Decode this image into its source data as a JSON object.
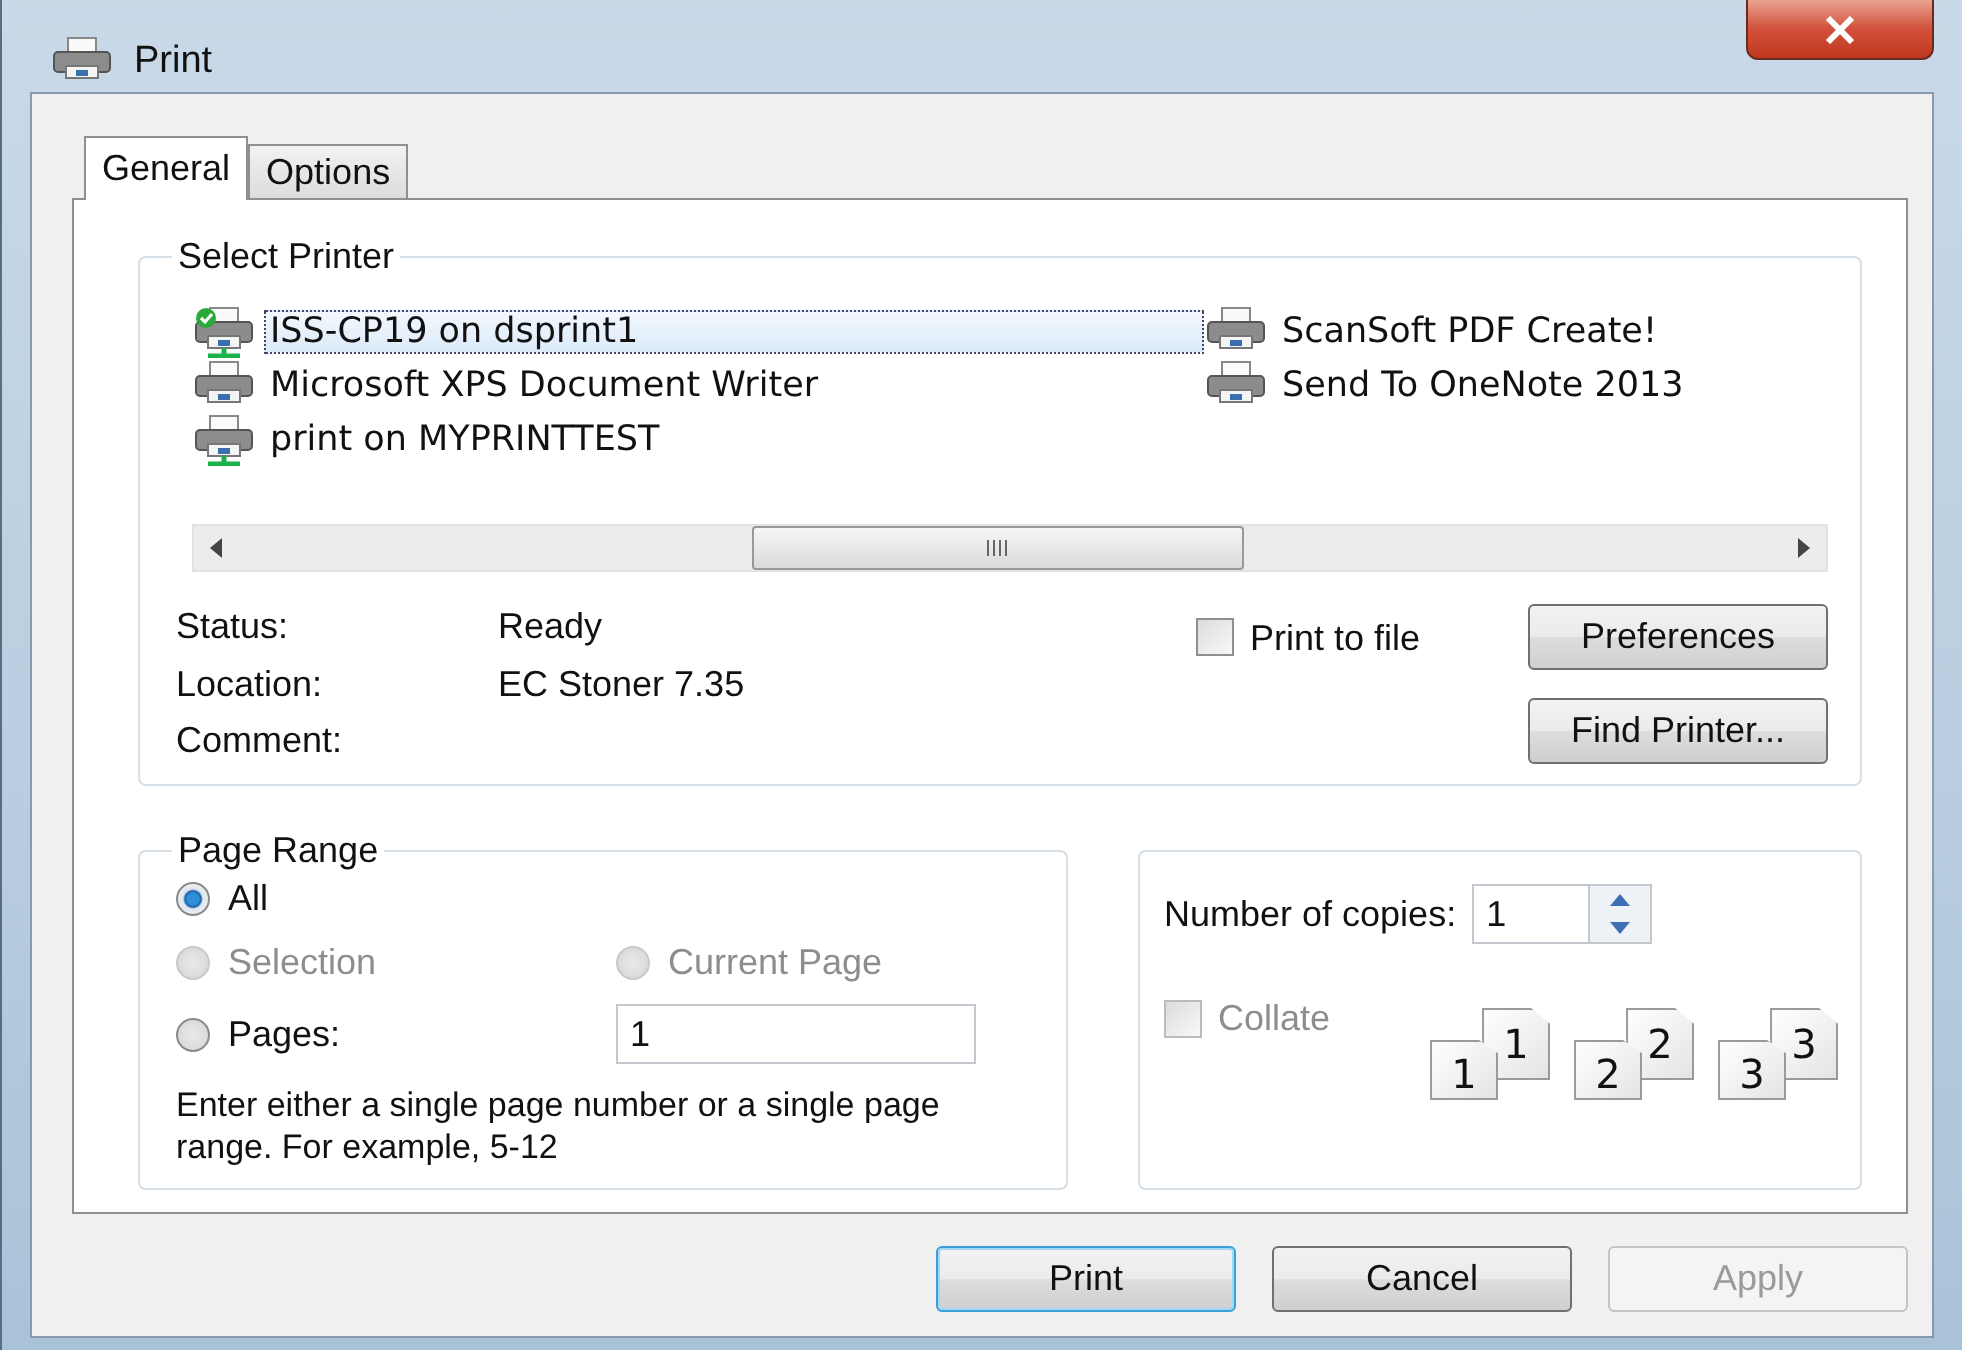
{
  "window": {
    "title": "Print"
  },
  "tabs": [
    {
      "label": "General",
      "selected": true
    },
    {
      "label": "Options",
      "selected": false
    }
  ],
  "select_printer": {
    "title": "Select Printer",
    "printers": [
      {
        "name": "ISS-CP19 on dsprint1",
        "selected": true,
        "default": true,
        "network": true
      },
      {
        "name": "Microsoft XPS Document Writer",
        "selected": false,
        "default": false,
        "network": false
      },
      {
        "name": "print on MYPRINTTEST",
        "selected": false,
        "default": false,
        "network": true
      },
      {
        "name": "ScanSoft PDF Create!",
        "selected": false,
        "default": false,
        "network": false
      },
      {
        "name": "Send To OneNote 2013",
        "selected": false,
        "default": false,
        "network": false
      }
    ],
    "details": [
      {
        "label": "Status:",
        "value": "Ready"
      },
      {
        "label": "Location:",
        "value": "EC Stoner 7.35"
      },
      {
        "label": "Comment:"
      }
    ],
    "print_to_file": {
      "label": "Print to file",
      "checked": false
    },
    "buttons": [
      {
        "label": "Preferences"
      },
      {
        "label": "Find Printer..."
      }
    ]
  },
  "page_range": {
    "title": "Page Range",
    "options": [
      {
        "label": "All",
        "selected": true,
        "disabled": false
      },
      {
        "label": "Selection",
        "selected": false,
        "disabled": true
      },
      {
        "label": "Current Page",
        "selected": false,
        "disabled": true
      },
      {
        "label": "Pages:",
        "selected": false,
        "disabled": false
      }
    ],
    "pages_field": {
      "value": "1"
    },
    "hint": "Enter either a single page number or a single page range.  For example, 5-12"
  },
  "copies": {
    "label": "Number of copies:",
    "value": "1",
    "collate": {
      "label": "Collate",
      "checked": false,
      "disabled": true
    },
    "collate_sets": [
      [
        "1",
        "1"
      ],
      [
        "2",
        "2"
      ],
      [
        "3",
        "3"
      ]
    ]
  },
  "buttons": [
    {
      "label": "Print",
      "default": true,
      "disabled": false
    },
    {
      "label": "Cancel",
      "default": false,
      "disabled": false
    },
    {
      "label": "Apply",
      "default": false,
      "disabled": true
    }
  ]
}
